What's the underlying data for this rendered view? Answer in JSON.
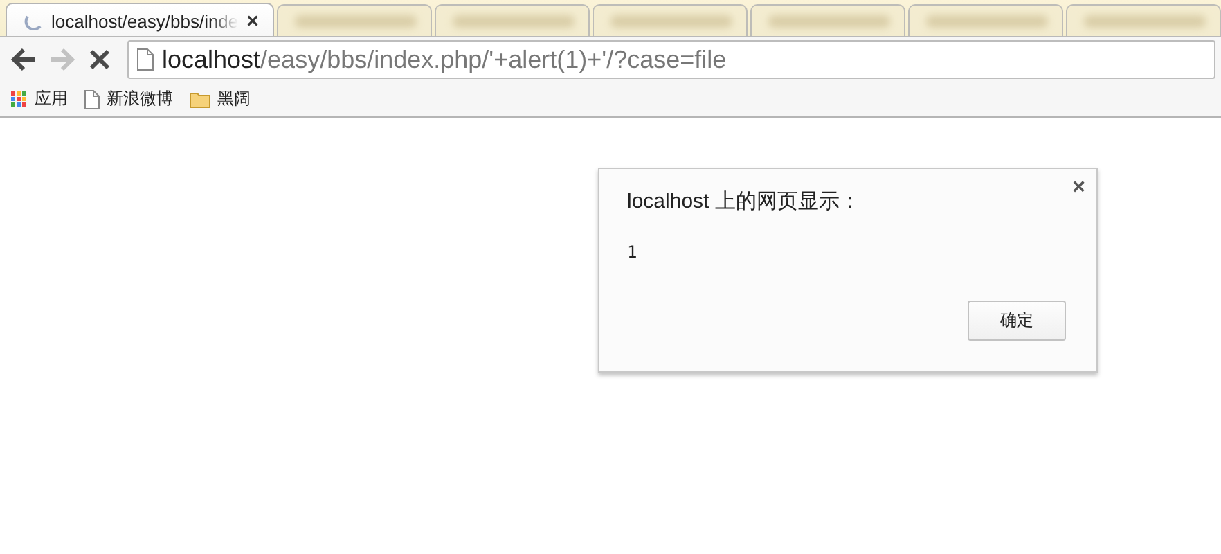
{
  "tabs": [
    {
      "title": "localhost/easy/bbs/inde",
      "close": "×",
      "selected": true,
      "loading": true
    },
    {
      "selected": false
    },
    {
      "selected": false
    },
    {
      "selected": false
    },
    {
      "selected": false
    },
    {
      "selected": false
    },
    {
      "selected": false
    }
  ],
  "nav_buttons": [
    {
      "kind": "back",
      "disabled": false
    },
    {
      "kind": "forward",
      "disabled": true
    },
    {
      "kind": "stop",
      "disabled": false
    }
  ],
  "address": {
    "host": "localhost",
    "path": "/easy/bbs/index.php/'+alert(1)+'/?case=file"
  },
  "bookmarks": [
    {
      "kind": "apps",
      "label": "应用"
    },
    {
      "kind": "page",
      "label": "新浪微博"
    },
    {
      "kind": "folder",
      "label": "黑阔"
    }
  ],
  "dialog": {
    "title": "localhost 上的网页显示：",
    "message": "1",
    "close": "×",
    "button": "确定"
  }
}
